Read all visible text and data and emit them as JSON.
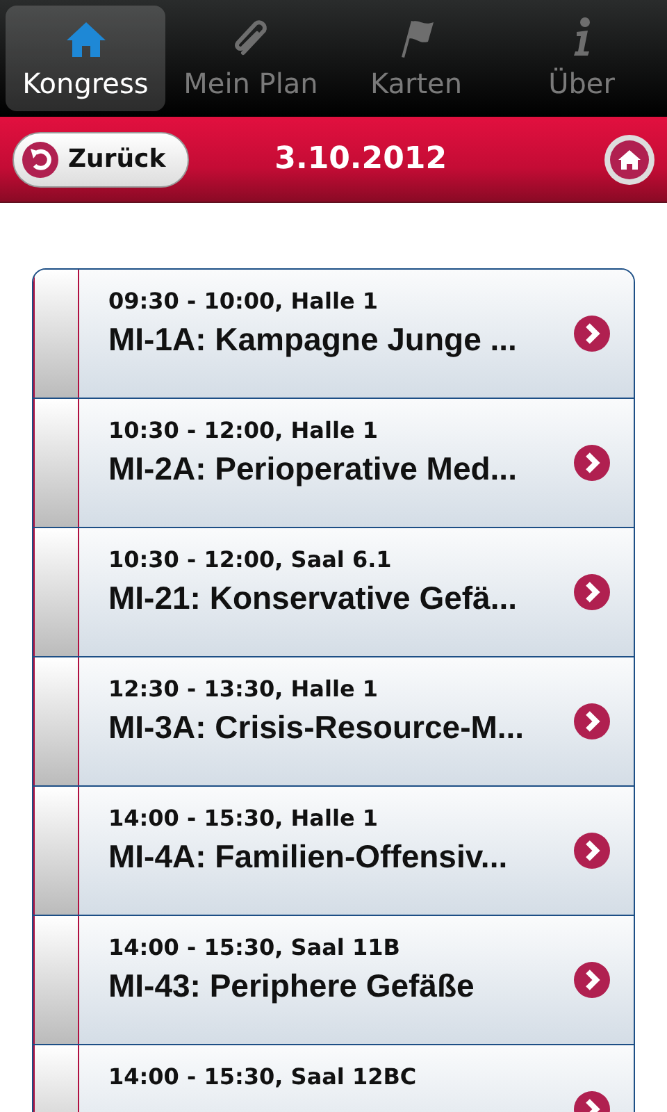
{
  "tabs": [
    {
      "label": "Kongress",
      "selected": true
    },
    {
      "label": "Mein Plan",
      "selected": false
    },
    {
      "label": "Karten",
      "selected": false
    },
    {
      "label": "Über",
      "selected": false
    }
  ],
  "header": {
    "back": "Zurück",
    "title": "3.10.2012"
  },
  "sessions": [
    {
      "time": "09:30 - 10:00, Halle 1",
      "title": "MI-1A: Kampagne Junge ..."
    },
    {
      "time": "10:30 - 12:00, Halle 1",
      "title": "MI-2A: Perioperative Med..."
    },
    {
      "time": "10:30 - 12:00, Saal 6.1",
      "title": "MI-21: Konservative Gefä..."
    },
    {
      "time": "12:30 - 13:30, Halle 1",
      "title": "MI-3A: Crisis-Resource-M..."
    },
    {
      "time": "14:00 - 15:30, Halle 1",
      "title": "MI-4A: Familien-Offensiv..."
    },
    {
      "time": "14:00 - 15:30, Saal 11B",
      "title": "MI-43: Periphere Gefäße"
    },
    {
      "time": "14:00 - 15:30, Saal 12BC"
    }
  ]
}
